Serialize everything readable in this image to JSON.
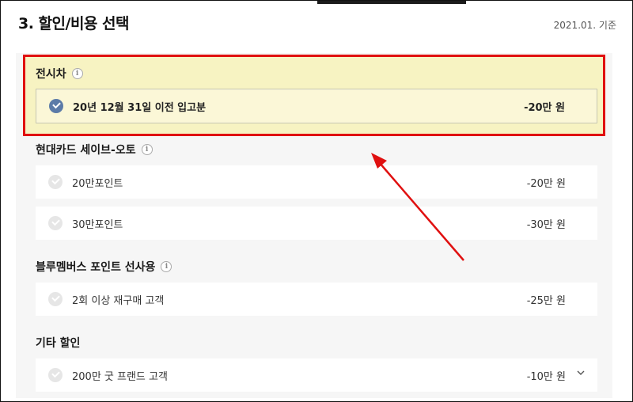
{
  "header": {
    "title": "3. 할인/비용 선택",
    "date_ref": "2021.01. 기준"
  },
  "sections": [
    {
      "title": "전시차",
      "info": "i",
      "options": [
        {
          "label": "20년 12월 31일 이전 입고분",
          "price": "-20만 원",
          "selected": true
        }
      ]
    },
    {
      "title": "현대카드 세이브-오토",
      "info": "i",
      "options": [
        {
          "label": "20만포인트",
          "price": "-20만 원",
          "selected": false
        },
        {
          "label": "30만포인트",
          "price": "-30만 원",
          "selected": false
        }
      ]
    },
    {
      "title": "블루멤버스 포인트 선사용",
      "info": "i",
      "options": [
        {
          "label": "2회 이상 재구매 고객",
          "price": "-25만 원",
          "selected": false
        }
      ]
    },
    {
      "title": "기타 할인",
      "options": [
        {
          "label": "200만 굿 프랜드 고객",
          "price": "-10만 원",
          "selected": false
        }
      ]
    }
  ],
  "colors": {
    "highlight_border": "#e01010",
    "selected_bg": "#f7f3c2",
    "check_selected": "#5c7ba8",
    "arrow": "#e01010"
  },
  "icons": [
    "check-circle-icon",
    "info-icon",
    "chevron-down-icon",
    "annotation-arrow"
  ]
}
